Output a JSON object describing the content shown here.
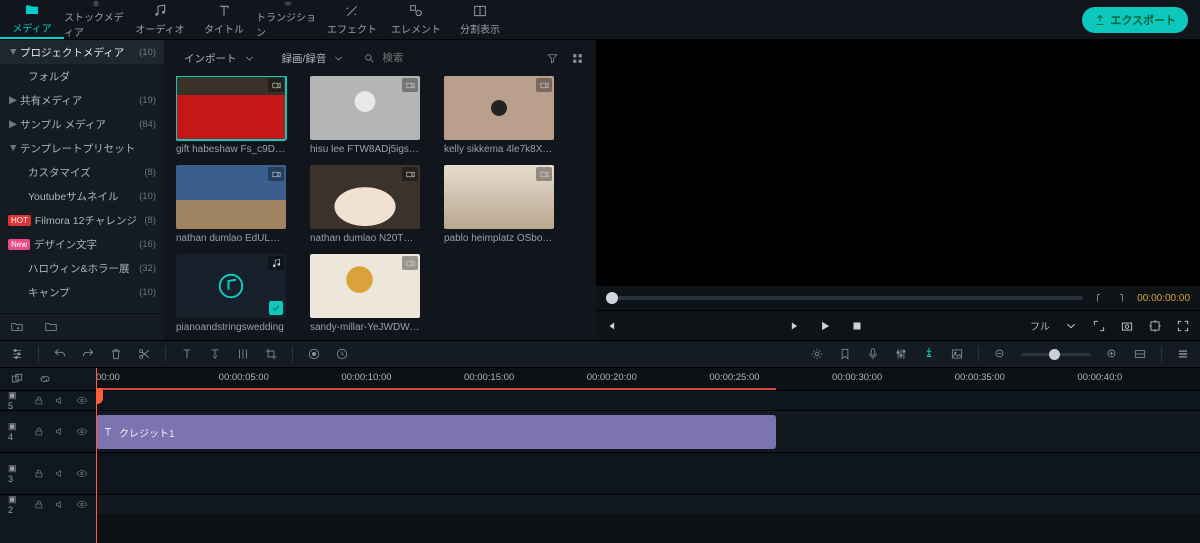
{
  "tabs": {
    "media": "メディア",
    "stock": "ストックメディア",
    "audio": "オーディオ",
    "title": "タイトル",
    "transition": "トランジション",
    "effect": "エフェクト",
    "element": "エレメント",
    "split": "分割表示"
  },
  "export_label": "エクスポート",
  "sidebar": {
    "header": {
      "label": "プロジェクトメディア",
      "count": "(10)"
    },
    "folder": "フォルダ",
    "shared": {
      "label": "共有メディア",
      "count": "(19)"
    },
    "sample": {
      "label": "サンプル メディア",
      "count": "(84)"
    },
    "template": {
      "label": "テンプレートプリセット"
    },
    "customize": {
      "label": "カスタマイズ",
      "count": "(8)"
    },
    "ytthumb": {
      "label": "Youtubeサムネイル",
      "count": "(10)"
    },
    "challenge": {
      "badge": "HOT",
      "label": "Filmora 12チャレンジ",
      "count": "(8)"
    },
    "design": {
      "badge": "New",
      "label": "デザイン文字",
      "count": "(16)"
    },
    "halloween": {
      "label": "ハロウィン&ホラー展",
      "count": "(32)"
    },
    "camp": {
      "label": "キャンプ",
      "count": "(10)"
    }
  },
  "browser": {
    "import": "インポート",
    "record": "録画/録音",
    "search_placeholder": "検索"
  },
  "media": [
    {
      "bg": "bg-roses",
      "type": "video",
      "label": "gift habeshaw Fs_c9Df4...",
      "active": true
    },
    {
      "bg": "bg-wedding",
      "type": "video",
      "label": "hisu lee FTW8ADj5igs u..."
    },
    {
      "bg": "bg-hands",
      "type": "video",
      "label": "kelly sikkema 4le7k8XVYju..."
    },
    {
      "bg": "bg-beach1",
      "type": "video",
      "label": "nathan dumlao EdULZp..."
    },
    {
      "bg": "bg-arch",
      "type": "video",
      "label": "nathan dumlao N20TNl..."
    },
    {
      "bg": "bg-hands2",
      "type": "video",
      "label": "pablo heimplatz OSboZ..."
    },
    {
      "bg": "bg-audio",
      "type": "audio",
      "label": "pianoandstringswedding",
      "checked": true
    },
    {
      "bg": "bg-rings",
      "type": "video",
      "label": "sandy-millar-YeJWDWeI7..."
    }
  ],
  "preview": {
    "time_left": "00:00:00:00",
    "playback_label": "フル"
  },
  "ruler": [
    "00:00",
    "00:00:05:00",
    "00:00:10:00",
    "00:00:15:00",
    "00:00:20:00",
    "00:00:25:00",
    "00:00:30:00",
    "00:00:35:00",
    "00:00:40:0"
  ],
  "tracks": {
    "t5": "5",
    "t4": "4",
    "t3": "3",
    "t2": "2"
  },
  "clip": {
    "title": "クレジット1"
  }
}
